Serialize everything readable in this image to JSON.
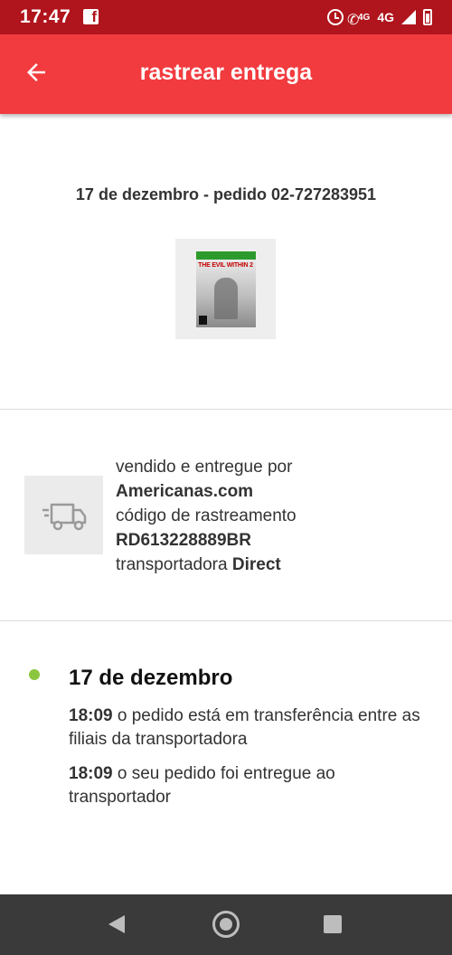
{
  "status_bar": {
    "time": "17:47",
    "call_label": "4G",
    "network_label": "4G"
  },
  "app_bar": {
    "title": "rastrear entrega"
  },
  "order": {
    "title": "17 de dezembro - pedido 02-727283951",
    "product_cover_text": "THE EVIL WITHIN 2"
  },
  "seller": {
    "sold_label": "vendido e entregue por",
    "seller_name": "Americanas.com",
    "tracking_label": "código de rastreamento",
    "tracking_code": "RD613228889BR",
    "carrier_label": "transportadora",
    "carrier_name": "Direct"
  },
  "tracking": {
    "date": "17 de dezembro",
    "events": [
      {
        "time": "18:09",
        "text": "o pedido está em transferência entre as filiais da transportadora"
      },
      {
        "time": "18:09",
        "text": "o seu pedido foi entregue ao transportador"
      }
    ]
  },
  "colors": {
    "status_bar": "#b0141c",
    "app_bar": "#f23b3f",
    "status_dot": "#8cc63f",
    "nav_bar": "#3a3a3a"
  },
  "icons": {
    "back": "arrow-left-icon",
    "truck": "truck-icon",
    "status_dot": "green-dot-icon"
  }
}
